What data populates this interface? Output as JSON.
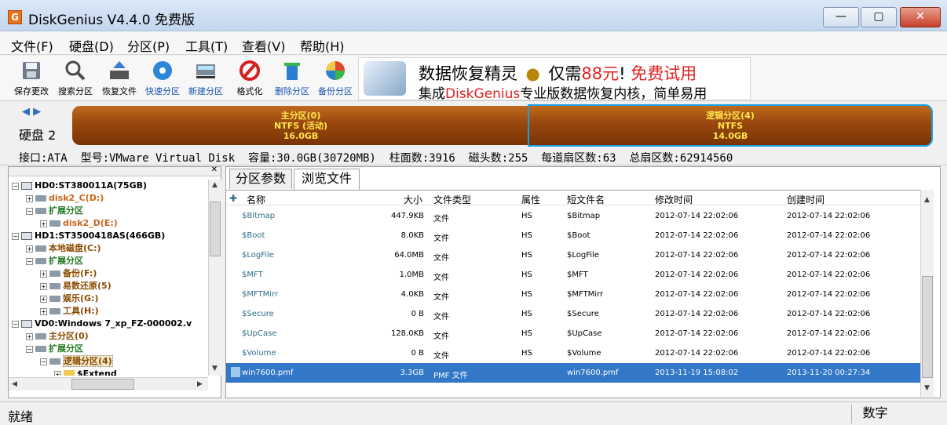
{
  "app": {
    "title": "DiskGenius V4.4.0 免费版",
    "icon_letter": "G"
  },
  "window_controls": {
    "minimize": "—",
    "maximize": "▢",
    "close": "✕"
  },
  "menu": [
    "文件(F)",
    "硬盘(D)",
    "分区(P)",
    "工具(T)",
    "查看(V)",
    "帮助(H)"
  ],
  "toolbar": [
    {
      "label": "保存更改",
      "icon": "save-icon"
    },
    {
      "label": "搜索分区",
      "icon": "search-icon"
    },
    {
      "label": "恢复文件",
      "icon": "recover-icon"
    },
    {
      "label": "快速分区",
      "icon": "quick-partition-icon"
    },
    {
      "label": "新建分区",
      "icon": "new-partition-icon"
    },
    {
      "label": "格式化",
      "icon": "format-icon"
    },
    {
      "label": "删除分区",
      "icon": "delete-icon"
    },
    {
      "label": "备份分区",
      "icon": "backup-icon"
    }
  ],
  "banner": {
    "line1_a": "数据恢复精灵",
    "line1_b": "仅需",
    "line1_price": "88元",
    "line1_c": "!",
    "line1_free": "免费试用",
    "line2_a": "集成",
    "line2_brand": "DiskGenius",
    "line2_b": "专业版数据恢复内核，简单易用"
  },
  "diskmap": {
    "disk_label": "硬盘 2",
    "primary": {
      "name": "主分区(0)",
      "fs": "NTFS (活动)",
      "size": "16.0GB"
    },
    "logical": {
      "name": "逻辑分区(4)",
      "fs": "NTFS",
      "size": "14.0GB"
    }
  },
  "disk_info": "接口:ATA  型号:VMware Virtual Disk  容量:30.0GB(30720MB)  柱面数:3916  磁头数:255  每道扇区数:63  总扇区数:62914560",
  "tree": [
    {
      "level": 0,
      "exp": "−",
      "type": "disk",
      "text": "HD0:ST380011A(75GB)",
      "color": "black"
    },
    {
      "level": 1,
      "exp": "+",
      "type": "part",
      "text": "disk2_C(D:)",
      "color": "orange"
    },
    {
      "level": 1,
      "exp": "−",
      "type": "part",
      "text": "扩展分区",
      "color": "green"
    },
    {
      "level": 2,
      "exp": "+",
      "type": "part",
      "text": "disk2_D(E:)",
      "color": "orange"
    },
    {
      "level": 0,
      "exp": "−",
      "type": "disk",
      "text": "HD1:ST3500418AS(466GB)",
      "color": "black"
    },
    {
      "level": 1,
      "exp": "+",
      "type": "part",
      "text": "本地磁盘(C:)",
      "color": "brown"
    },
    {
      "level": 1,
      "exp": "−",
      "type": "part",
      "text": "扩展分区",
      "color": "green"
    },
    {
      "level": 2,
      "exp": "+",
      "type": "part",
      "text": "备份(F:)",
      "color": "brown"
    },
    {
      "level": 2,
      "exp": "+",
      "type": "part",
      "text": "易数还原(5)",
      "color": "brown"
    },
    {
      "level": 2,
      "exp": "+",
      "type": "part",
      "text": "娱乐(G:)",
      "color": "brown"
    },
    {
      "level": 2,
      "exp": "+",
      "type": "part",
      "text": "工具(H:)",
      "color": "brown"
    },
    {
      "level": 0,
      "exp": "−",
      "type": "disk",
      "text": "VD0:Windows 7_xp_FZ-000002.v",
      "color": "black"
    },
    {
      "level": 1,
      "exp": "+",
      "type": "part",
      "text": "主分区(0)",
      "color": "brown"
    },
    {
      "level": 1,
      "exp": "−",
      "type": "part",
      "text": "扩展分区",
      "color": "green"
    },
    {
      "level": 2,
      "exp": "−",
      "type": "part",
      "text": "逻辑分区(4)",
      "color": "brown",
      "selected": true
    },
    {
      "level": 3,
      "exp": "+",
      "type": "folder",
      "text": "$Extend",
      "color": "black"
    }
  ],
  "tabs": [
    "分区参数",
    "浏览文件"
  ],
  "columns": [
    "名称",
    "大小",
    "文件类型",
    "属性",
    "短文件名",
    "修改时间",
    "创建时间"
  ],
  "files": [
    [
      "$Bitmap",
      "447.9KB",
      "文件",
      "HS",
      "$Bitmap",
      "2012-07-14 22:02:06",
      "2012-07-14 22:02:06"
    ],
    [
      "$Boot",
      "8.0KB",
      "文件",
      "HS",
      "$Boot",
      "2012-07-14 22:02:06",
      "2012-07-14 22:02:06"
    ],
    [
      "$LogFile",
      "64.0MB",
      "文件",
      "HS",
      "$LogFile",
      "2012-07-14 22:02:06",
      "2012-07-14 22:02:06"
    ],
    [
      "$MFT",
      "1.0MB",
      "文件",
      "HS",
      "$MFT",
      "2012-07-14 22:02:06",
      "2012-07-14 22:02:06"
    ],
    [
      "$MFTMirr",
      "4.0KB",
      "文件",
      "HS",
      "$MFTMirr",
      "2012-07-14 22:02:06",
      "2012-07-14 22:02:06"
    ],
    [
      "$Secure",
      "0 B",
      "文件",
      "HS",
      "$Secure",
      "2012-07-14 22:02:06",
      "2012-07-14 22:02:06"
    ],
    [
      "$UpCase",
      "128.0KB",
      "文件",
      "HS",
      "$UpCase",
      "2012-07-14 22:02:06",
      "2012-07-14 22:02:06"
    ],
    [
      "$Volume",
      "0 B",
      "文件",
      "HS",
      "$Volume",
      "2012-07-14 22:02:06",
      "2012-07-14 22:02:06"
    ],
    [
      "win7600.pmf",
      "3.3GB",
      "PMF 文件",
      "",
      "win7600.pmf",
      "2013-11-19 15:08:02",
      "2013-11-20 00:27:34"
    ]
  ],
  "selected_file_index": 8,
  "status": {
    "text": "就绪",
    "num": "数字"
  }
}
